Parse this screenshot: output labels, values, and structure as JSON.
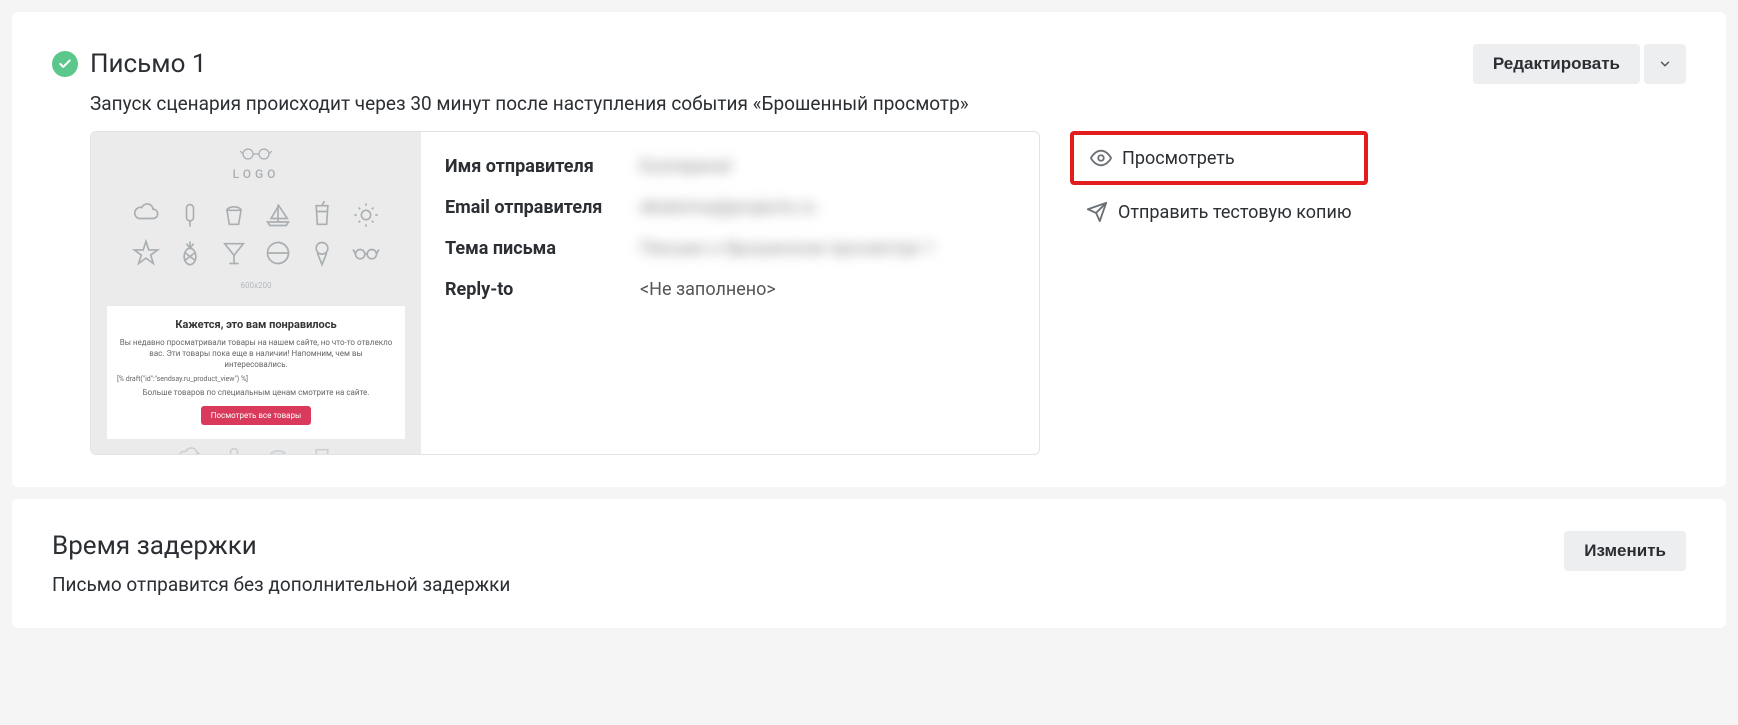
{
  "letter": {
    "title": "Письмо 1",
    "subtitle": "Запуск сценария происходит через 30 минут после наступления события «Брошенный просмотр»",
    "edit_button": "Редактировать"
  },
  "thumb": {
    "logo": "LOGO",
    "placeholder_dim": "600x200",
    "heading": "Кажется, это вам понравилось",
    "body1": "Вы недавно просматривали товары на нашем сайте, но что-то отвлекло вас. Эти товары пока еще в наличии! Напомним, чем вы интересовались.",
    "code": "[% draft(\"id\":\"sendsay.ru_product_view\") %]",
    "body2": "Больше товаров по специальным ценам смотрите на сайте.",
    "button": "Посмотреть все товары"
  },
  "info": {
    "sender_name_label": "Имя отправителя",
    "sender_name_value": "Екатерина!",
    "sender_email_label": "Email отправителя",
    "sender_email_value": "ekaterina@projects.ru",
    "subject_label": "Тема письма",
    "subject_value": "Письмо о брошенном просмотре 1",
    "reply_to_label": "Reply-to",
    "reply_to_value": "<Не заполнено>"
  },
  "actions": {
    "preview": "Просмотреть",
    "send_test": "Отправить тестовую копию"
  },
  "delay": {
    "title": "Время задержки",
    "text": "Письмо отправится без дополнительной задержки",
    "edit_button": "Изменить"
  }
}
